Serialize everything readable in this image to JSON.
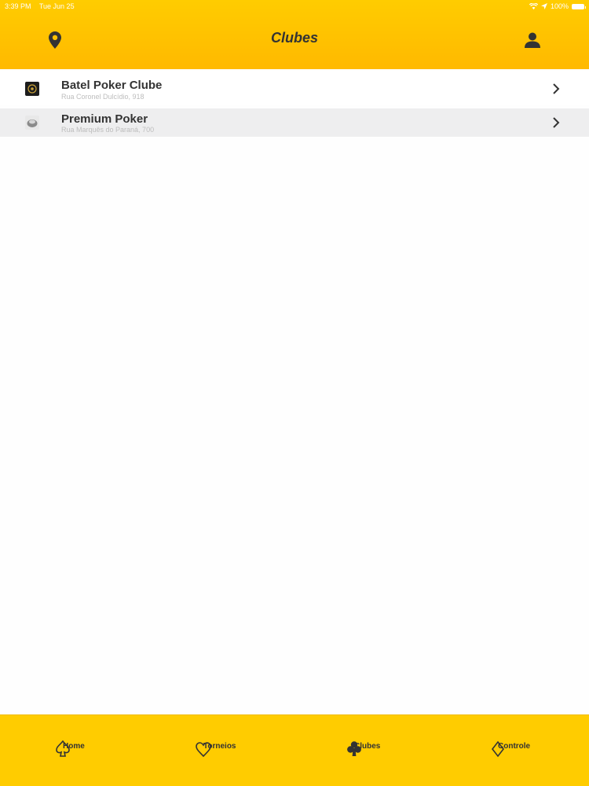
{
  "status_bar": {
    "time": "3:39 PM",
    "date": "Tue Jun 25",
    "battery": "100%"
  },
  "nav": {
    "title": "Clubes",
    "left_icon": "map-pin-icon",
    "right_icon": "user-icon"
  },
  "clubs": [
    {
      "name": "Batel Poker Clube",
      "address": "Rua Coronel Dulcídio, 918"
    },
    {
      "name": "Premium Poker",
      "address": "Rua Marquês do Paraná, 700"
    }
  ],
  "tabs": [
    {
      "label": "Home",
      "icon": "spade-outline-icon"
    },
    {
      "label": "Torneios",
      "icon": "heart-outline-icon"
    },
    {
      "label": "Clubes",
      "icon": "club-filled-icon"
    },
    {
      "label": "Controle",
      "icon": "diamond-outline-icon"
    }
  ],
  "colors": {
    "header": "#ffcc00",
    "tabbar": "#ffcc00",
    "text_dark": "#333333",
    "row_alt": "#eeeeef"
  }
}
